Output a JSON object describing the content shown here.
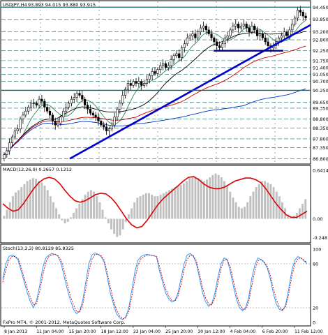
{
  "header": {
    "symbol": "USDJPY,H4",
    "ohlc": "93.893 94.015 93.880 93.915"
  },
  "macd_label": "MACD(12,26,9) 0.2657 0.1212",
  "stoch_label": "Stoch(13,3,3) 80.8129 85.8325",
  "footer": "FxPro MT4, © 2001-2012, MetaQuotes Software Corp.",
  "colors": {
    "candles": "#000000",
    "trendline": "#0000cc",
    "hline": "#000088",
    "ma_green": "#2e8b57",
    "ma_red": "#cc0000",
    "ma_blue": "#0033cc",
    "ma_black": "#000000",
    "macd_hist": "#c0c0c0",
    "macd_signal": "#dd0000",
    "stoch_main": "#1e90ff",
    "stoch_signal": "#cc0000"
  },
  "chart_data": [
    {
      "type": "candlestick",
      "panel": "price",
      "y_ticks": [
        "94.450",
        "93.850",
        "93.200",
        "92.800",
        "92.250",
        "91.750",
        "91.400",
        "91.050",
        "90.700",
        "90.250",
        "89.650",
        "89.350",
        "88.800",
        "88.350",
        "87.800",
        "87.350",
        "86.800"
      ],
      "ylim": [
        86.6,
        94.6
      ],
      "x_ticks": [
        "8 Jan 2013",
        "11 Jan 04:00",
        "15 Jan 20:00",
        "18 Jan 12:00",
        "23 Jan 04:00",
        "25 Jan 20:00",
        "30 Jan 12:00",
        "4 Feb 04:00",
        "6 Feb 20:00",
        "11 Feb 12:00"
      ],
      "close": [
        87.0,
        87.2,
        87.6,
        87.9,
        88.2,
        88.3,
        88.8,
        89.0,
        89.2,
        89.4,
        89.6,
        89.6,
        89.5,
        89.8,
        89.7,
        89.4,
        89.2,
        89.0,
        88.7,
        88.5,
        88.6,
        88.9,
        89.2,
        89.4,
        89.6,
        89.8,
        89.9,
        90.1,
        90.0,
        89.8,
        89.5,
        89.3,
        89.1,
        89.0,
        88.9,
        88.7,
        88.5,
        88.4,
        88.2,
        88.3,
        88.5,
        88.9,
        89.3,
        89.6,
        90.0,
        90.3,
        90.6,
        90.5,
        90.7,
        90.6,
        90.7,
        90.5,
        90.6,
        90.8,
        91.0,
        91.2,
        91.1,
        91.3,
        91.5,
        91.6,
        91.4,
        91.5,
        91.8,
        92.0,
        92.1,
        91.9,
        92.4,
        92.6,
        92.9,
        93.0,
        93.1,
        92.9,
        93.2,
        93.4,
        93.5,
        93.3,
        93.1,
        92.9,
        92.7,
        92.5,
        92.4,
        92.6,
        92.9,
        93.0,
        93.3,
        93.5,
        93.6,
        93.4,
        93.5,
        93.6,
        93.4,
        93.2,
        93.5,
        93.3,
        93.0,
        93.1,
        92.9,
        92.7,
        92.5,
        92.4,
        92.5,
        92.7,
        92.9,
        93.0,
        93.2,
        93.0,
        93.3,
        93.6,
        93.9,
        94.3,
        94.2,
        94.0,
        93.9
      ],
      "trendline": [
        [
          87.3,
          "8 Jan 2013"
        ],
        [
          93.6,
          "end"
        ]
      ],
      "horizontal_line": 92.25,
      "moving_averages": [
        "green",
        "black",
        "red",
        "blue"
      ]
    },
    {
      "type": "bar+line",
      "panel": "MACD(12,26,9)",
      "y_ticks": [
        "0.6414",
        "0.00",
        "-0.2481"
      ],
      "ylim": [
        -0.3,
        0.68
      ],
      "histogram": [
        0.04,
        0.12,
        0.22,
        0.3,
        0.35,
        0.38,
        0.42,
        0.46,
        0.5,
        0.52,
        0.54,
        0.53,
        0.5,
        0.48,
        0.44,
        0.38,
        0.3,
        0.22,
        0.14,
        0.06,
        -0.02,
        -0.06,
        -0.04,
        0.02,
        0.08,
        0.14,
        0.2,
        0.26,
        0.32,
        0.36,
        0.38,
        0.36,
        0.3,
        0.22,
        0.12,
        0.02,
        -0.06,
        -0.14,
        -0.2,
        -0.24,
        -0.22,
        -0.14,
        -0.04,
        0.06,
        0.14,
        0.22,
        0.28,
        0.3,
        0.32,
        0.34,
        0.34,
        0.32,
        0.3,
        0.3,
        0.32,
        0.34,
        0.36,
        0.38,
        0.4,
        0.42,
        0.44,
        0.45,
        0.47,
        0.5,
        0.54,
        0.56,
        0.55,
        0.54,
        0.52,
        0.5,
        0.52,
        0.55,
        0.58,
        0.6,
        0.58,
        0.55,
        0.5,
        0.44,
        0.36,
        0.28,
        0.22,
        0.16,
        0.14,
        0.16,
        0.22,
        0.3,
        0.36,
        0.42,
        0.46,
        0.5,
        0.5,
        0.48,
        0.46,
        0.42,
        0.36,
        0.3,
        0.22,
        0.14,
        0.06,
        0.02,
        0.04,
        0.08,
        0.14,
        0.2,
        0.26
      ],
      "signal": [
        0.2,
        0.14,
        0.1,
        0.12,
        0.2,
        0.3,
        0.4,
        0.48,
        0.53,
        0.55,
        0.53,
        0.47,
        0.38,
        0.3,
        0.24,
        0.22,
        0.24,
        0.28,
        0.32,
        0.34,
        0.33,
        0.28,
        0.2,
        0.1,
        0.0,
        -0.08,
        -0.12,
        -0.1,
        -0.02,
        0.08,
        0.18,
        0.26,
        0.32,
        0.38,
        0.44,
        0.5,
        0.55,
        0.56,
        0.52,
        0.46,
        0.42,
        0.4,
        0.4,
        0.42,
        0.46,
        0.5,
        0.52,
        0.54,
        0.54,
        0.52,
        0.48,
        0.4,
        0.3,
        0.2,
        0.12,
        0.05,
        0.02,
        0.02,
        0.06,
        0.1
      ],
      "signal_value": 0.1212,
      "histogram_value": 0.2657
    },
    {
      "type": "line",
      "panel": "Stoch(13,3,3)",
      "y_ticks": [
        "100",
        "80",
        "20",
        "0"
      ],
      "ylim": [
        0,
        100
      ],
      "series": [
        {
          "name": "main",
          "values": [
            60,
            80,
            90,
            92,
            90,
            85,
            70,
            55,
            40,
            28,
            20,
            30,
            50,
            75,
            88,
            92,
            94,
            93,
            90,
            80,
            62,
            45,
            30,
            18,
            12,
            15,
            30,
            55,
            80,
            92,
            95,
            93,
            90,
            82,
            62,
            40,
            25,
            12,
            6,
            4,
            8,
            20,
            45,
            70,
            85,
            90,
            92,
            93,
            92,
            91,
            90,
            70,
            55,
            40,
            32,
            28,
            30,
            40,
            60,
            80,
            92,
            94,
            90,
            80,
            60,
            40,
            28,
            22,
            26,
            40,
            62,
            80,
            88,
            86,
            70,
            50,
            32,
            20,
            16,
            20,
            34,
            60,
            78,
            88,
            86,
            82,
            75,
            60,
            40,
            25,
            18,
            16,
            24,
            45,
            70,
            85,
            90,
            88,
            84,
            80
          ]
        },
        {
          "name": "signal",
          "values": [
            55,
            72,
            85,
            90,
            90,
            87,
            75,
            60,
            46,
            34,
            24,
            26,
            42,
            65,
            82,
            90,
            92,
            93,
            91,
            85,
            70,
            52,
            36,
            24,
            15,
            14,
            24,
            46,
            70,
            86,
            93,
            93,
            91,
            85,
            68,
            48,
            30,
            17,
            9,
            5,
            6,
            15,
            36,
            60,
            78,
            87,
            90,
            92,
            92,
            91,
            90,
            76,
            60,
            46,
            36,
            30,
            29,
            36,
            52,
            72,
            86,
            92,
            91,
            84,
            66,
            47,
            33,
            25,
            24,
            34,
            54,
            74,
            85,
            86,
            76,
            57,
            39,
            25,
            18,
            18,
            28,
            50,
            70,
            84,
            86,
            83,
            77,
            65,
            47,
            31,
            21,
            17,
            21,
            38,
            62,
            80,
            87,
            88,
            85,
            82
          ]
        }
      ],
      "stoch_main_value": 80.8129,
      "stoch_signal_value": 85.8325
    }
  ]
}
